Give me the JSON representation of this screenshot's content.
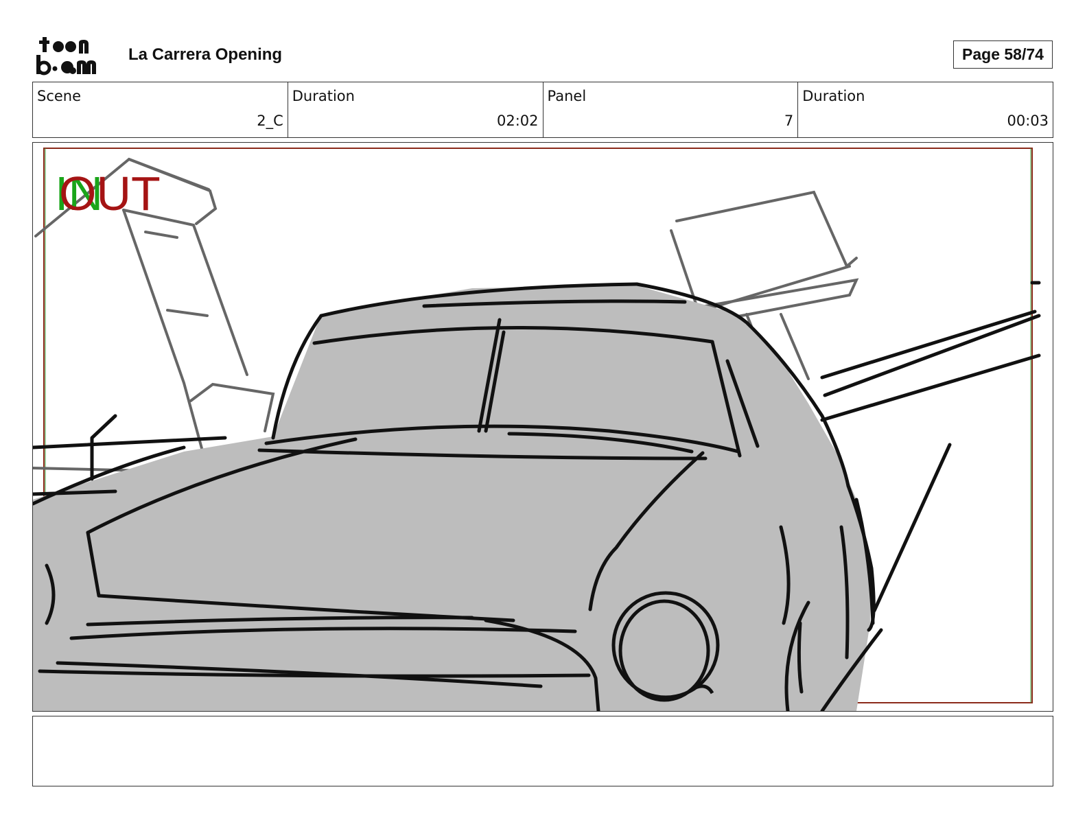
{
  "header": {
    "logo": "Toon Boom logo",
    "title": "La Carrera Opening",
    "page": "Page 58/74"
  },
  "info": {
    "scene_label": "Scene",
    "scene_value": "2_C",
    "scene_duration_label": "Duration",
    "scene_duration_value": "02:02",
    "panel_label": "Panel",
    "panel_value": "7",
    "panel_duration_label": "Duration",
    "panel_duration_value": "00:03"
  },
  "panel": {
    "in_marker": "IN",
    "out_marker": "OUT",
    "in_color": "#1aa51a",
    "out_color": "#a51414",
    "car_fill_color": "#bdbdbd"
  },
  "notes": {
    "text": ""
  }
}
